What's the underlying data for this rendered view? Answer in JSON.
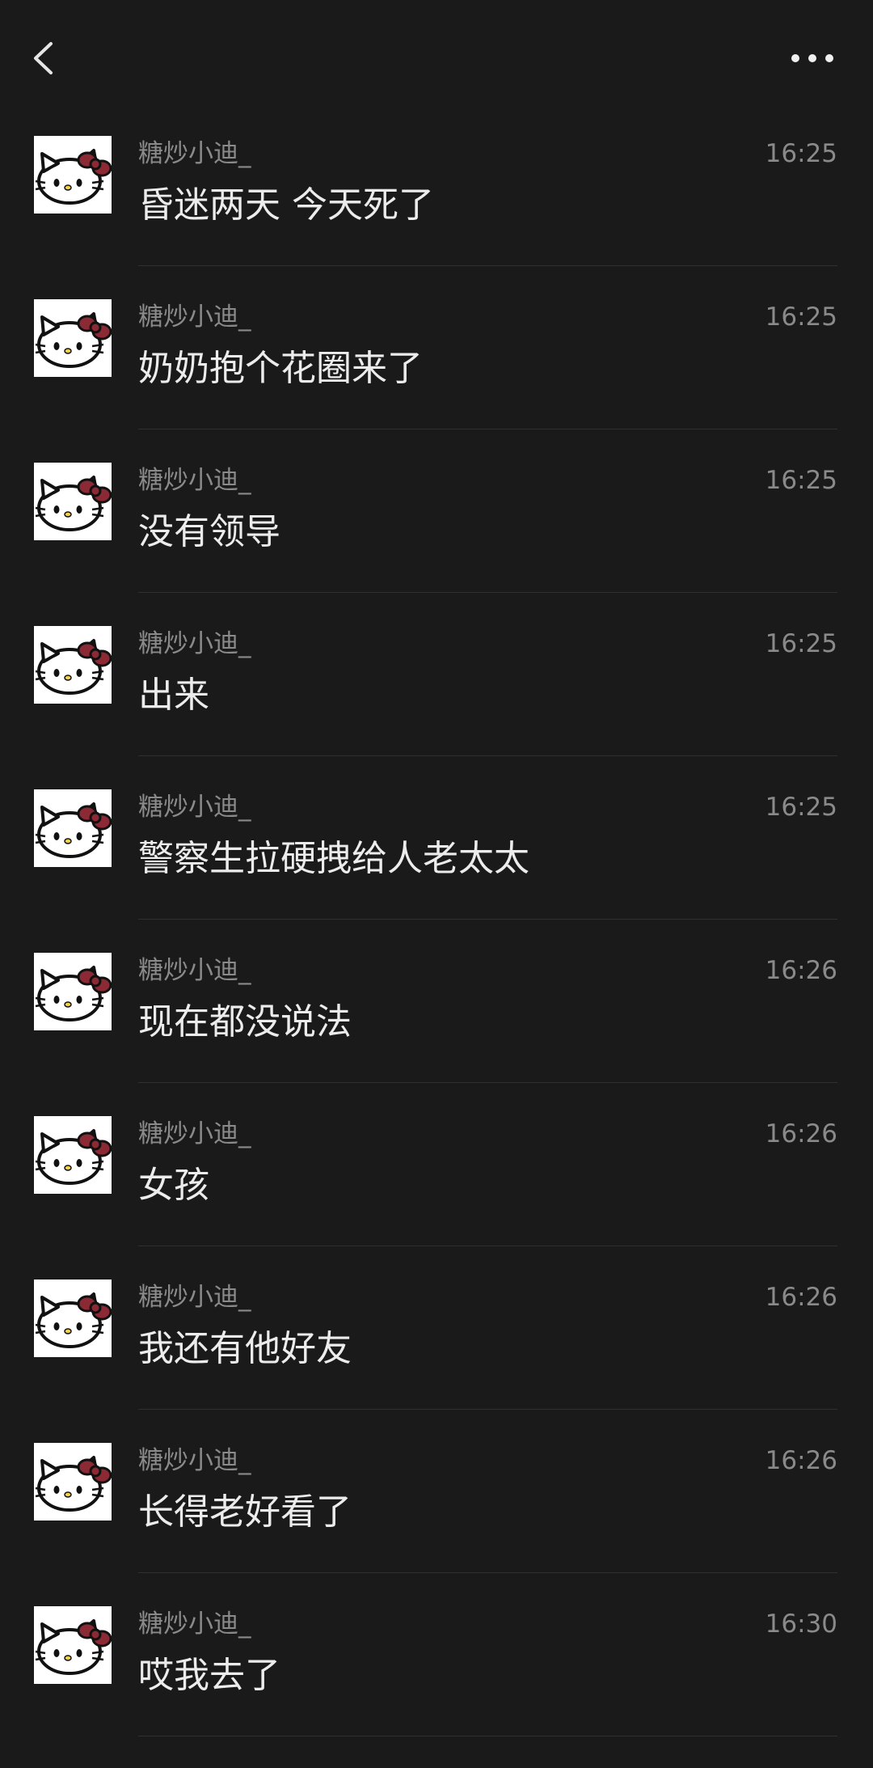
{
  "header": {
    "back_icon": "chevron-left-icon",
    "more_icon": "more-horizontal-icon"
  },
  "avatar_icon": "hello-kitty-avatar-icon",
  "messages": [
    {
      "sender": "糖炒小迪_",
      "time": "16:25",
      "text": "昏迷两天  今天死了"
    },
    {
      "sender": "糖炒小迪_",
      "time": "16:25",
      "text": "奶奶抱个花圈来了"
    },
    {
      "sender": "糖炒小迪_",
      "time": "16:25",
      "text": "没有领导"
    },
    {
      "sender": "糖炒小迪_",
      "time": "16:25",
      "text": "出来"
    },
    {
      "sender": "糖炒小迪_",
      "time": "16:25",
      "text": "警察生拉硬拽给人老太太"
    },
    {
      "sender": "糖炒小迪_",
      "time": "16:26",
      "text": "现在都没说法"
    },
    {
      "sender": "糖炒小迪_",
      "time": "16:26",
      "text": "女孩"
    },
    {
      "sender": "糖炒小迪_",
      "time": "16:26",
      "text": "我还有他好友"
    },
    {
      "sender": "糖炒小迪_",
      "time": "16:26",
      "text": "长得老好看了"
    },
    {
      "sender": "糖炒小迪_",
      "time": "16:30",
      "text": "哎我去了"
    }
  ]
}
